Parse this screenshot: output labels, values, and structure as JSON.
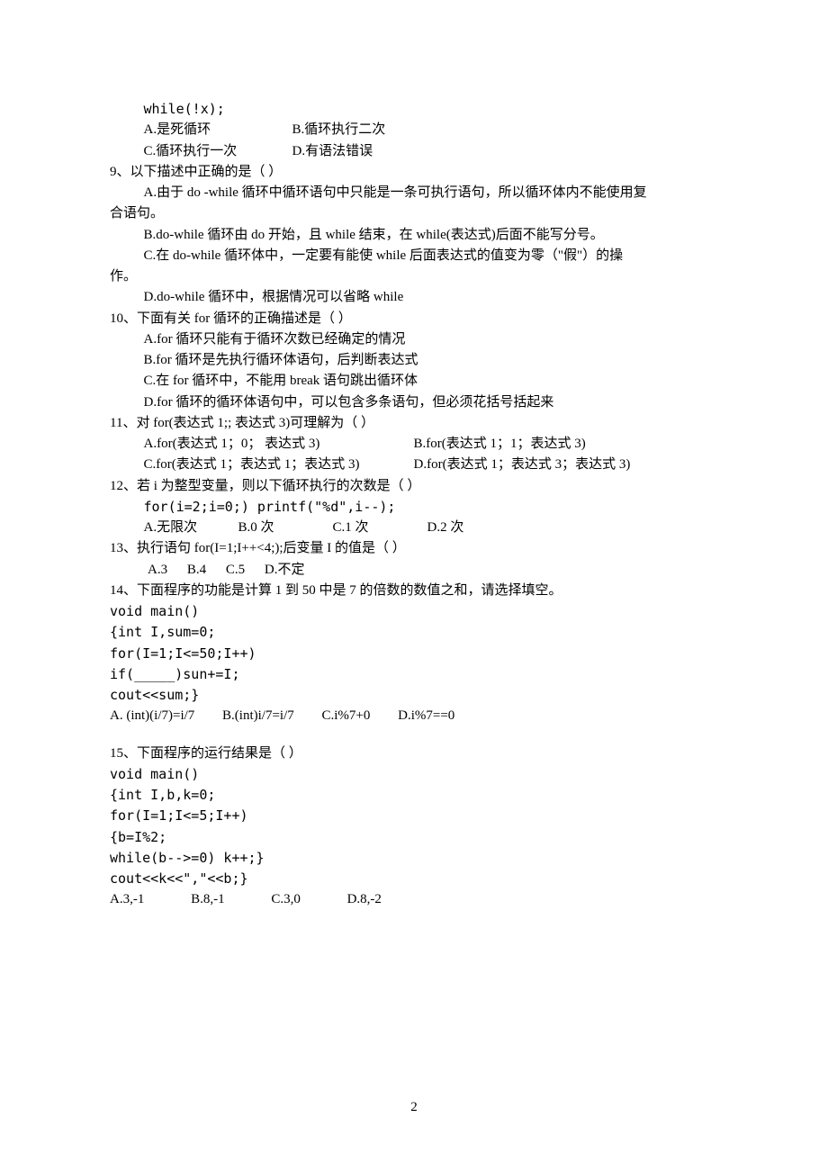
{
  "pre": {
    "l1": "while(!x);",
    "opt_a": "A.是死循环",
    "opt_b": "B.循环执行二次",
    "opt_c": "C.循环执行一次",
    "opt_d": "D.有语法错误"
  },
  "q9": {
    "stem": "9、以下描述中正确的是（    ）",
    "a1": "A.由于 do -while 循环中循环语句中只能是一条可执行语句，所以循环体内不能使用复",
    "a2": "合语句。",
    "b": "B.do-while 循环由 do 开始，且 while 结束，在 while(表达式)后面不能写分号。",
    "c1": "C.在 do-while 循环体中，一定要有能使 while 后面表达式的值变为零（\"假\"）的操",
    "c2": "作。",
    "d": "D.do-while 循环中，根据情况可以省略 while"
  },
  "q10": {
    "stem": "10、下面有关 for 循环的正确描述是（    ）",
    "a": "A.for 循环只能有于循环次数已经确定的情况",
    "b": "B.for 循环是先执行循环体语句，后判断表达式",
    "c": "C.在 for 循环中，不能用 break 语句跳出循环体",
    "d": "D.for 循环的循环体语句中，可以包含多条语句，但必须花括号括起来"
  },
  "q11": {
    "stem": "11、对 for(表达式 1;; 表达式 3)可理解为（  ）",
    "a": "A.for(表达式 1；0； 表达式 3)",
    "b": "B.for(表达式 1；1；表达式 3)",
    "c": "C.for(表达式 1；表达式 1；表达式 3)",
    "d": "D.for(表达式 1；表达式 3；表达式 3)"
  },
  "q12": {
    "stem": "12、若 i 为整型变量，则以下循环执行的次数是（    ）",
    "code": "for(i=2;i=0;) printf(\"%d\",i--);",
    "a": "A.无限次",
    "b": "B.0 次",
    "c": "C.1 次",
    "d": "D.2 次"
  },
  "q13": {
    "stem": "13、执行语句 for(I=1;I++<4;);后变量 I 的值是（    ）",
    "a": "A.3",
    "b": "B.4",
    "c": "C.5",
    "d": "D.不定"
  },
  "q14": {
    "stem": "14、下面程序的功能是计算 1 到 50 中是 7 的倍数的数值之和，请选择填空。",
    "c1": "void main()",
    "c2": "{int I,sum=0;",
    "c3": "for(I=1;I<=50;I++)",
    "c4": "if(_____)sun+=I;",
    "c5": "cout<<sum;}",
    "a": "A. (int)(i/7)=i/7",
    "b": "B.(int)i/7=i/7",
    "c": "C.i%7+0",
    "d": "D.i%7==0"
  },
  "q15": {
    "stem": "15、下面程序的运行结果是（  ）",
    "c1": "void main()",
    "c2": "{int I,b,k=0;",
    "c3": "for(I=1;I<=5;I++)",
    "c4": "{b=I%2;",
    "c5": "while(b-->=0) k++;}",
    "c6": "cout<<k<<\",\"<<b;}",
    "a": "A.3,-1",
    "b": "B.8,-1",
    "c": "C.3,0",
    "d": "D.8,-2"
  },
  "pageNumber": "2"
}
